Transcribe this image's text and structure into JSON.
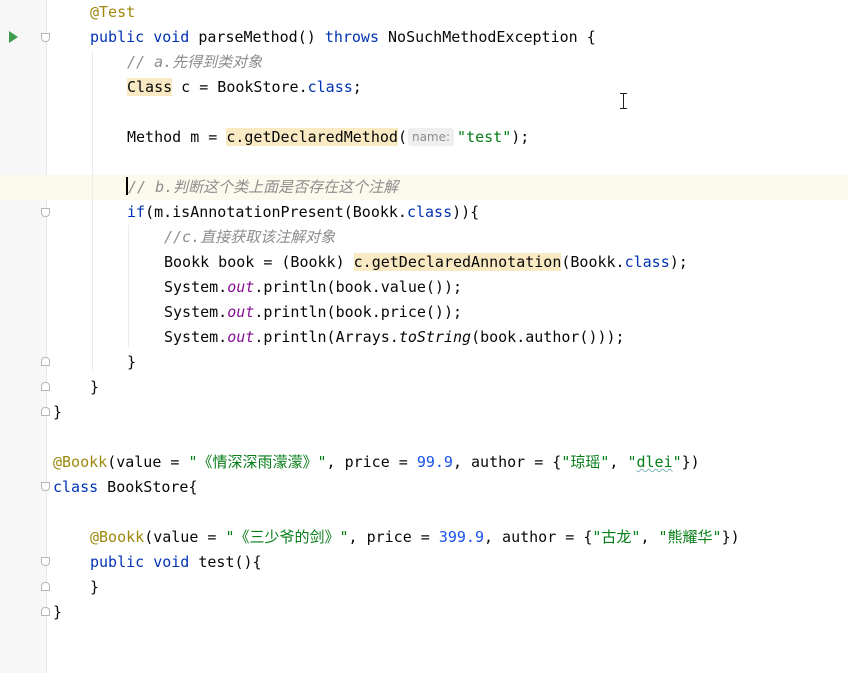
{
  "icons": {
    "run": "run-test-icon",
    "fold": "fold-marker-icon",
    "cursor": "text-cursor-icon"
  },
  "colors": {
    "keyword": "#0033b3",
    "annotation": "#9e880d",
    "string": "#067d17",
    "number": "#1750eb",
    "comment": "#8c8c8c",
    "static_field": "#871094",
    "highlight": "#f9eac3"
  },
  "code": {
    "l1": {
      "annotation": "@Test"
    },
    "l2": {
      "public": "public",
      "void": "void",
      "name": "parseMethod()",
      "throws": "throws",
      "exception": "NoSuchMethodException {"
    },
    "l3": {
      "comment": "// a.先得到类对象"
    },
    "l4": {
      "class_kw": "Class",
      "rest": " c = BookStore.",
      "class_suffix": "class",
      "end": ";"
    },
    "l6": {
      "start": "Method m = ",
      "call": "c.getDeclaredMethod",
      "open": "(",
      "hint": "name:",
      "arg": "\"test\"",
      "end": ");"
    },
    "l7": {
      "comment": "// b.判断这个类上面是否存在这个注解"
    },
    "l8": {
      "if_kw": "if",
      "mid": "(m.isAnnotationPresent(Bookk.",
      "class_suffix": "class",
      "end": ")){"
    },
    "l9": {
      "comment": "//c.直接获取该注解对象"
    },
    "l10": {
      "start": "Bookk book = (Bookk) ",
      "call": "c.getDeclaredAnnotation",
      "mid": "(Bookk.",
      "class_suffix": "class",
      "end": ");"
    },
    "l11": {
      "system": "System.",
      "out": "out",
      "rest": ".println(book.value());"
    },
    "l12": {
      "system": "System.",
      "out": "out",
      "rest": ".println(book.price());"
    },
    "l13": {
      "system": "System.",
      "out": "out",
      "mid": ".println(Arrays.",
      "to_string": "toString",
      "end": "(book.author()));"
    },
    "l14": {
      "text": "}"
    },
    "l15": {
      "text": "}"
    },
    "l16": {
      "text": "}"
    },
    "l18": {
      "annotation": "@Bookk",
      "p1": "(value = ",
      "value": "\"《情深深雨濛濛》\"",
      "p2": ", price = ",
      "price": "99.9",
      "p3": ", author = {",
      "author1": "\"琼瑶\"",
      "comma": ", ",
      "author2_open": "\"",
      "author2_word": "dlei",
      "author2_close": "\"",
      "end": "})"
    },
    "l19": {
      "class_kw": "class",
      "rest": " BookStore{"
    },
    "l21": {
      "annotation": "@Bookk",
      "p1": "(value = ",
      "value": "\"《三少爷的剑》\"",
      "p2": ", price = ",
      "price": "399.9",
      "p3": ", author = {",
      "author1": "\"古龙\"",
      "comma": ", ",
      "author2": "\"熊耀华\"",
      "end": "})"
    },
    "l22": {
      "public": "public",
      "void": "void",
      "rest": " test(){"
    },
    "l23": {
      "text": "}"
    },
    "l24": {
      "text": "}"
    }
  }
}
